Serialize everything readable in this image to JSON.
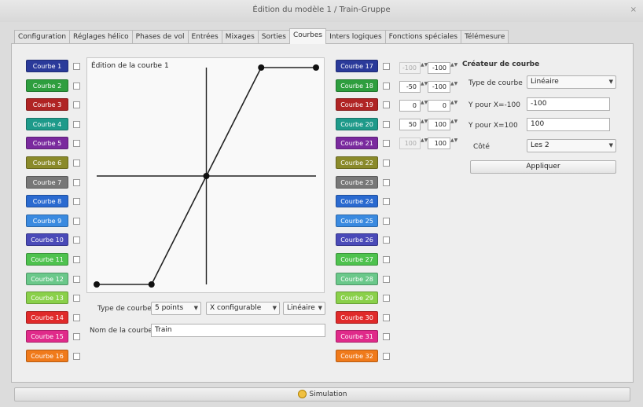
{
  "window": {
    "title": "Édition du modèle 1 / Train-Gruppe",
    "close_glyph": "×"
  },
  "tabs": [
    {
      "label": "Configuration",
      "active": false
    },
    {
      "label": "Réglages hélico",
      "active": false
    },
    {
      "label": "Phases de vol",
      "active": false
    },
    {
      "label": "Entrées",
      "active": false
    },
    {
      "label": "Mixages",
      "active": false
    },
    {
      "label": "Sorties",
      "active": false
    },
    {
      "label": "Courbes",
      "active": true
    },
    {
      "label": "Inters logiques",
      "active": false
    },
    {
      "label": "Fonctions spéciales",
      "active": false
    },
    {
      "label": "Télémesure",
      "active": false
    }
  ],
  "curves_left": [
    {
      "label": "Courbe 1",
      "color": "#2a3a9a"
    },
    {
      "label": "Courbe 2",
      "color": "#2e9e3e"
    },
    {
      "label": "Courbe 3",
      "color": "#b02424"
    },
    {
      "label": "Courbe 4",
      "color": "#1e9a8a"
    },
    {
      "label": "Courbe 5",
      "color": "#7a2a9e"
    },
    {
      "label": "Courbe 6",
      "color": "#8a8a2a"
    },
    {
      "label": "Courbe 7",
      "color": "#777777"
    },
    {
      "label": "Courbe 8",
      "color": "#2a6ad0"
    },
    {
      "label": "Courbe 9",
      "color": "#3a8ae0"
    },
    {
      "label": "Courbe 10",
      "color": "#4a4ab8"
    },
    {
      "label": "Courbe 11",
      "color": "#4ec24e"
    },
    {
      "label": "Courbe 12",
      "color": "#6ac88a"
    },
    {
      "label": "Courbe 13",
      "color": "#8ad04a"
    },
    {
      "label": "Courbe 14",
      "color": "#e02a2a"
    },
    {
      "label": "Courbe 15",
      "color": "#e02a8a"
    },
    {
      "label": "Courbe 16",
      "color": "#f07a1a"
    }
  ],
  "curves_right": [
    {
      "label": "Courbe 17",
      "color": "#2a3a9a"
    },
    {
      "label": "Courbe 18",
      "color": "#2e9e3e"
    },
    {
      "label": "Courbe 19",
      "color": "#b02424"
    },
    {
      "label": "Courbe 20",
      "color": "#1e9a8a"
    },
    {
      "label": "Courbe 21",
      "color": "#7a2a9e"
    },
    {
      "label": "Courbe 22",
      "color": "#8a8a2a"
    },
    {
      "label": "Courbe 23",
      "color": "#777777"
    },
    {
      "label": "Courbe 24",
      "color": "#2a6ad0"
    },
    {
      "label": "Courbe 25",
      "color": "#3a8ae0"
    },
    {
      "label": "Courbe 26",
      "color": "#4a4ab8"
    },
    {
      "label": "Courbe 27",
      "color": "#4ec24e"
    },
    {
      "label": "Courbe 28",
      "color": "#6ac88a"
    },
    {
      "label": "Courbe 29",
      "color": "#8ad04a"
    },
    {
      "label": "Courbe 30",
      "color": "#e02a2a"
    },
    {
      "label": "Courbe 31",
      "color": "#e02a8a"
    },
    {
      "label": "Courbe 32",
      "color": "#f07a1a"
    }
  ],
  "graph": {
    "title": "Édition de la courbe 1",
    "x_range": [
      -100,
      100
    ],
    "y_range": [
      -100,
      100
    ],
    "points": [
      [
        -100,
        -100
      ],
      [
        -50,
        -100
      ],
      [
        0,
        0
      ],
      [
        50,
        100
      ],
      [
        100,
        100
      ]
    ]
  },
  "points_table": [
    {
      "x": "-100",
      "y": "-100",
      "x_disabled": true
    },
    {
      "x": "-50",
      "y": "-100",
      "x_disabled": false
    },
    {
      "x": "0",
      "y": "0",
      "x_disabled": false
    },
    {
      "x": "50",
      "y": "100",
      "x_disabled": false
    },
    {
      "x": "100",
      "y": "100",
      "x_disabled": true
    }
  ],
  "curve_settings": {
    "type_label": "Type de courbe",
    "points_value": "5 points",
    "x_mode_value": "X configurable",
    "smoothing_value": "Linéaire",
    "name_label": "Nom de la courbe",
    "name_value": "Train"
  },
  "creator": {
    "title": "Créateur de courbe",
    "type_label": "Type de courbe",
    "type_value": "Linéaire",
    "y_min_label": "Y pour X=-100",
    "y_min_value": "-100",
    "y_max_label": "Y pour X=100",
    "y_max_value": "100",
    "side_label": "Côté",
    "side_value": "Les 2",
    "apply_label": "Appliquer"
  },
  "footer": {
    "simulation_label": "Simulation"
  },
  "glyphs": {
    "dropdown": "▼",
    "spin": "▲▼"
  }
}
